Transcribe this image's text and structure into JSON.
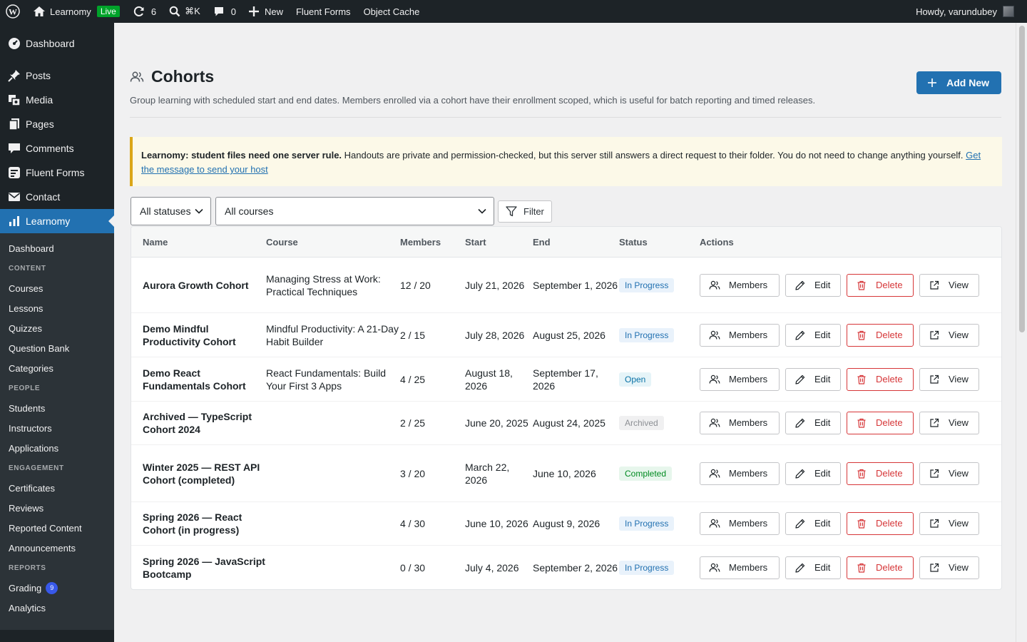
{
  "adminbar": {
    "site_name": "Learnomy",
    "live_label": "Live",
    "updates_count": "6",
    "search_shortcut": "⌘K",
    "comments_count": "0",
    "new_label": "New",
    "link1": "Fluent Forms",
    "link2": "Object Cache",
    "howdy": "Howdy, varundubey"
  },
  "sidebar": {
    "top_items": [
      {
        "label": "Dashboard",
        "icon": "dashboard-icon"
      },
      {
        "label": "Posts",
        "icon": "pin-icon"
      },
      {
        "label": "Media",
        "icon": "media-icon"
      },
      {
        "label": "Pages",
        "icon": "pages-icon"
      },
      {
        "label": "Comments",
        "icon": "comment-icon"
      },
      {
        "label": "Fluent Forms",
        "icon": "forms-icon"
      },
      {
        "label": "Contact",
        "icon": "mail-icon"
      },
      {
        "label": "Learnomy",
        "icon": "chart-icon"
      }
    ],
    "sub": {
      "dashboard": "Dashboard",
      "content_head": "CONTENT",
      "courses": "Courses",
      "lessons": "Lessons",
      "quizzes": "Quizzes",
      "question_bank": "Question Bank",
      "categories": "Categories",
      "people_head": "PEOPLE",
      "students": "Students",
      "instructors": "Instructors",
      "applications": "Applications",
      "engagement_head": "ENGAGEMENT",
      "certificates": "Certificates",
      "reviews": "Reviews",
      "reported": "Reported Content",
      "announcements": "Announcements",
      "reports_head": "REPORTS",
      "grading": "Grading",
      "grading_count": "9",
      "analytics": "Analytics"
    }
  },
  "page": {
    "title": "Cohorts",
    "subtitle": "Group learning with scheduled start and end dates. Members enrolled via a cohort have their enrollment scoped, which is useful for batch reporting and timed releases.",
    "add_new": "Add New"
  },
  "notice": {
    "bold": "Learnomy: student files need one server rule.",
    "text": " Handouts are private and permission-checked, but this server still answers a direct request to their folder. You do not need to change anything yourself. ",
    "link": "Get the message to send your host"
  },
  "filters": {
    "status": "All statuses",
    "course": "All courses",
    "filter": "Filter"
  },
  "table": {
    "headers": {
      "name": "Name",
      "course": "Course",
      "members": "Members",
      "start": "Start",
      "end": "End",
      "status": "Status",
      "actions": "Actions"
    },
    "actions": {
      "members": "Members",
      "edit": "Edit",
      "delete": "Delete",
      "view": "View"
    },
    "rows": [
      {
        "name": "Aurora Growth Cohort",
        "course": "Managing Stress at Work: Practical Techniques",
        "members": "12 / 20",
        "start": "July 21, 2026",
        "end": "September 1, 2026",
        "status": "In Progress"
      },
      {
        "name": "Demo Mindful Productivity Cohort",
        "course": "Mindful Productivity: A 21-Day Habit Builder",
        "members": "2 / 15",
        "start": "July 28, 2026",
        "end": "August 25, 2026",
        "status": "In Progress"
      },
      {
        "name": "Demo React Fundamentals Cohort",
        "course": "React Fundamentals: Build Your First 3 Apps",
        "members": "4 / 25",
        "start": "August 18, 2026",
        "end": "September 17, 2026",
        "status": "Open"
      },
      {
        "name": "Archived — TypeScript Cohort 2024",
        "course": "",
        "members": "2 / 25",
        "start": "June 20, 2025",
        "end": "August 24, 2025",
        "status": "Archived"
      },
      {
        "name": "Winter 2025 — REST API Cohort (completed)",
        "course": "",
        "members": "3 / 20",
        "start": "March 22, 2026",
        "end": "June 10, 2026",
        "status": "Completed"
      },
      {
        "name": "Spring 2026 — React Cohort (in progress)",
        "course": "",
        "members": "4 / 30",
        "start": "June 10, 2026",
        "end": "August 9, 2026",
        "status": "In Progress"
      },
      {
        "name": "Spring 2026 — JavaScript Bootcamp",
        "course": "",
        "members": "0 / 30",
        "start": "July 4, 2026",
        "end": "September 2, 2026",
        "status": "In Progress"
      }
    ]
  },
  "status_colors": {
    "In Progress": {
      "bg": "#e9f2fb",
      "fg": "#2271b1"
    },
    "Open": {
      "bg": "#e6f4f8",
      "fg": "#0a72a6"
    },
    "Archived": {
      "bg": "#f0f0f1",
      "fg": "#8c8f94"
    },
    "Completed": {
      "bg": "#e7f6ec",
      "fg": "#008a20"
    }
  }
}
